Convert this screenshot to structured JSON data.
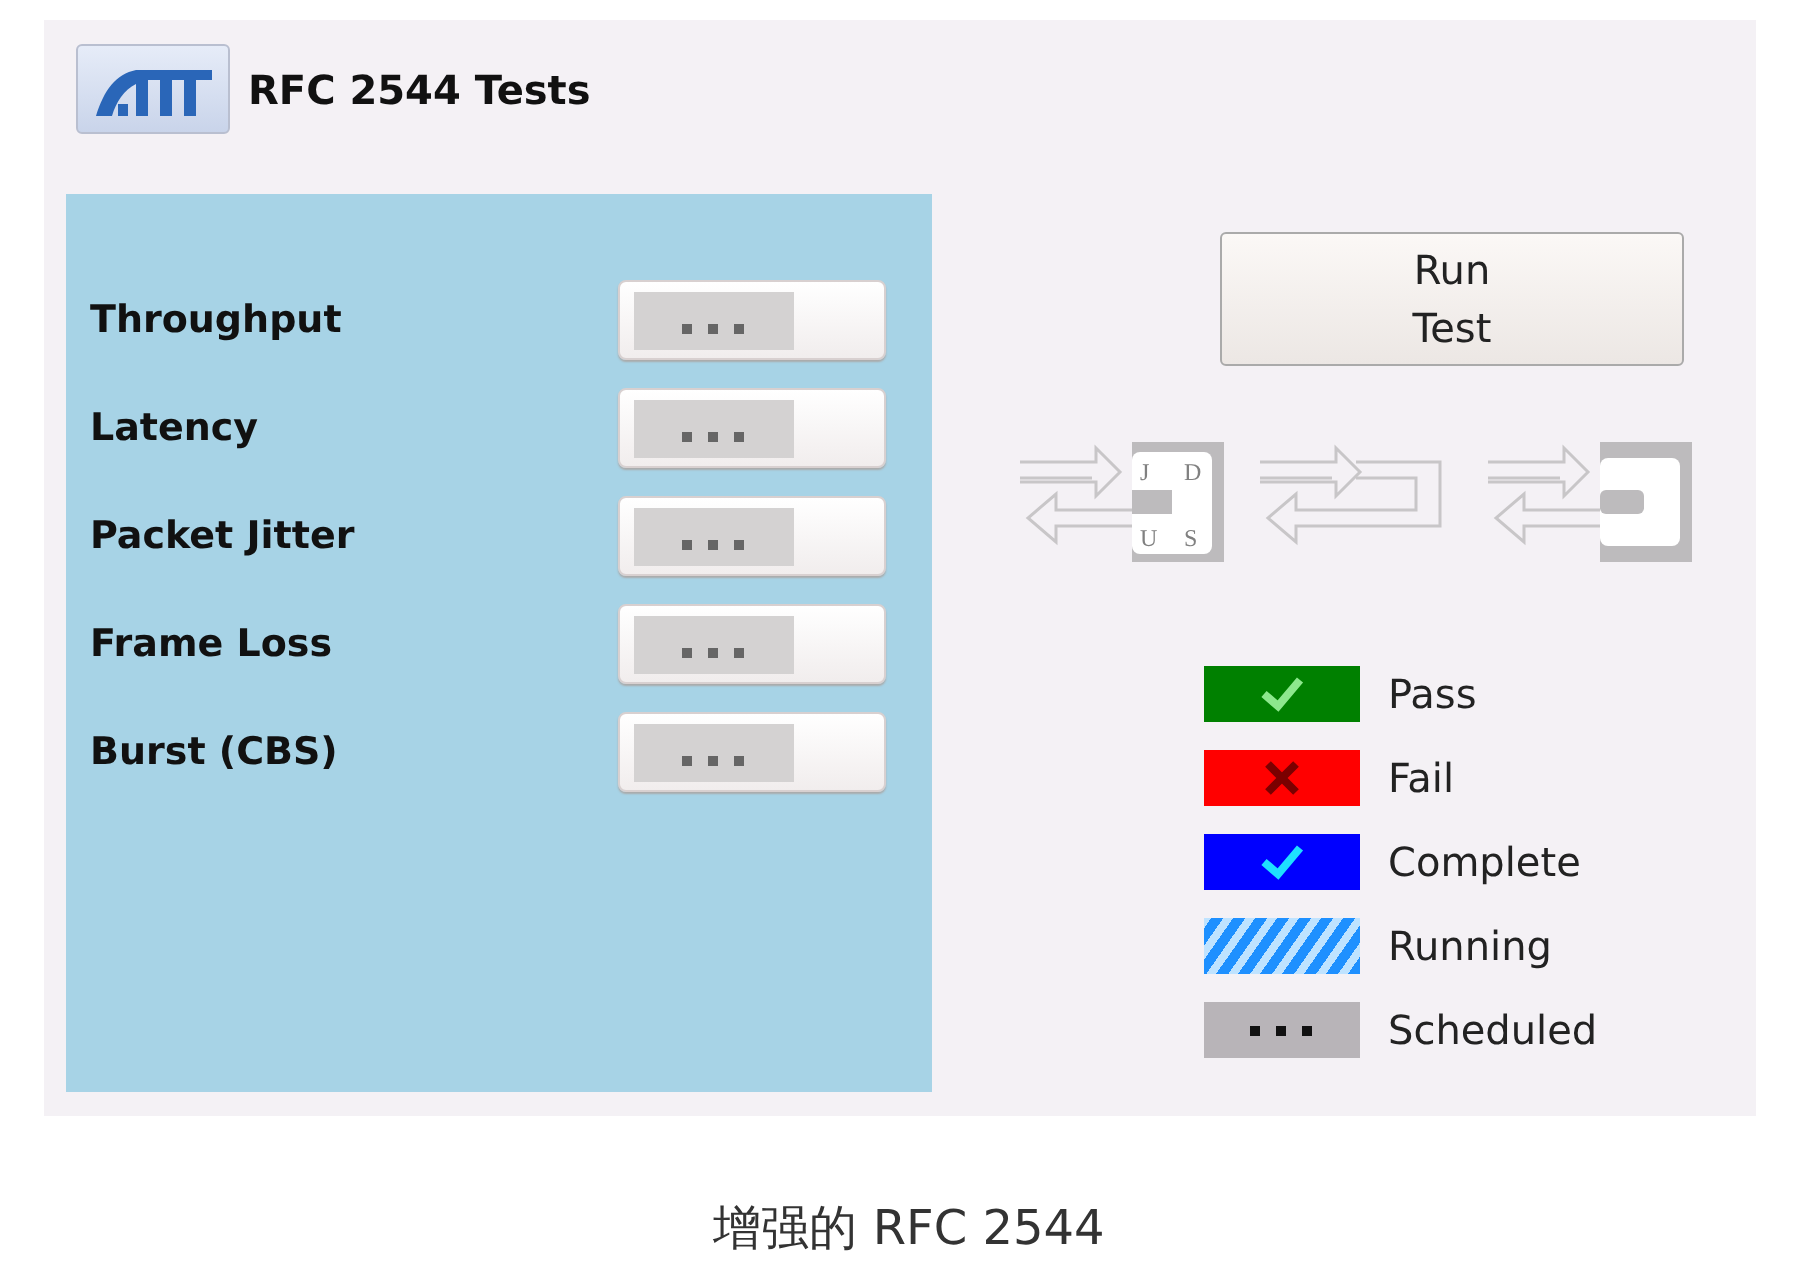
{
  "header": {
    "title": "RFC 2544 Tests"
  },
  "tests": [
    {
      "label": "Throughput"
    },
    {
      "label": "Latency"
    },
    {
      "label": "Packet Jitter"
    },
    {
      "label": "Frame Loss"
    },
    {
      "label": "Burst (CBS)"
    }
  ],
  "run_button": {
    "label": "Run\nTest"
  },
  "loopbacks": [
    {
      "kind": "jdus",
      "letters": [
        "J",
        "D",
        "U",
        "S"
      ]
    },
    {
      "kind": "physical"
    },
    {
      "kind": "local"
    }
  ],
  "legend": [
    {
      "kind": "pass",
      "label": "Pass",
      "color": "#008000"
    },
    {
      "kind": "fail",
      "label": "Fail",
      "color": "#ff0000"
    },
    {
      "kind": "complete",
      "label": "Complete",
      "color": "#0000ff"
    },
    {
      "kind": "running",
      "label": "Running",
      "color": "#1e90ff"
    },
    {
      "kind": "scheduled",
      "label": "Scheduled",
      "color": "#b8b4b8"
    }
  ],
  "caption": "增强的 RFC 2544"
}
